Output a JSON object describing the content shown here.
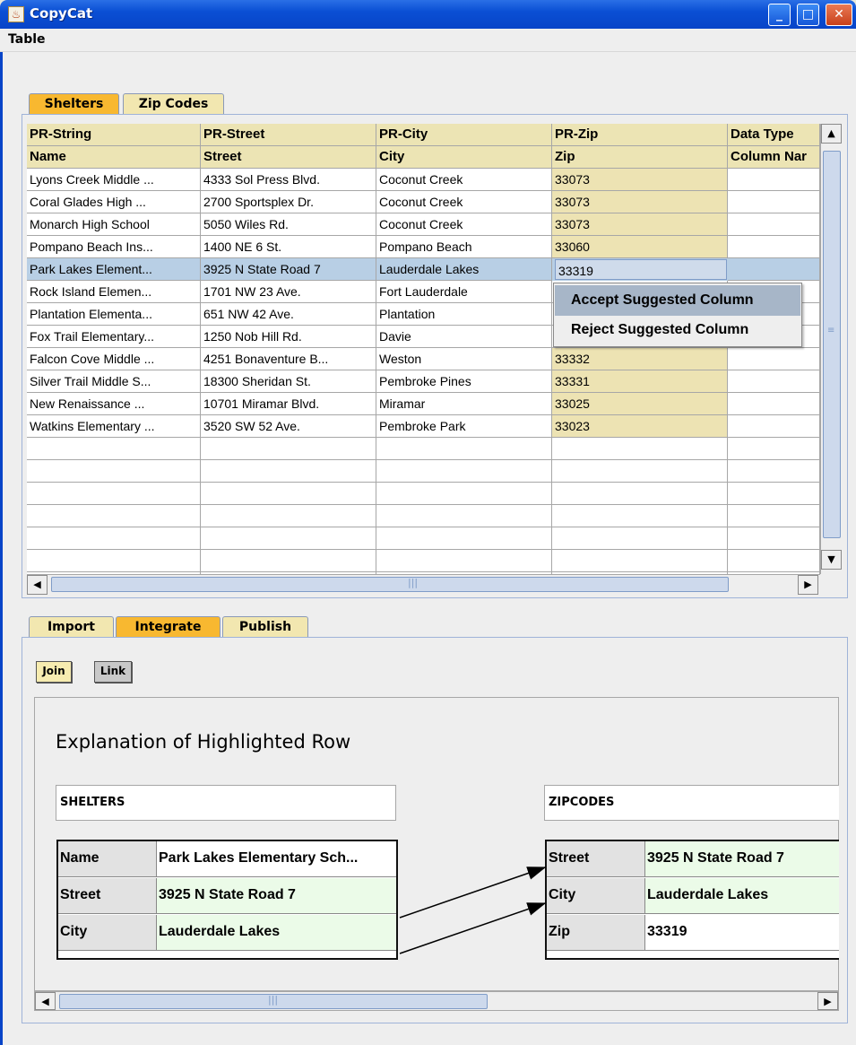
{
  "window": {
    "title": "CopyCat",
    "app_icon": "java-cup-icon",
    "buttons": [
      "minimize",
      "maximize",
      "close"
    ],
    "minimize_glyph": "_",
    "maximize_glyph": "□",
    "close_glyph": "✕"
  },
  "menu": {
    "items": [
      "Table"
    ]
  },
  "top_tabs": [
    {
      "label": "Shelters",
      "active": true
    },
    {
      "label": "Zip Codes",
      "active": false
    }
  ],
  "table": {
    "header1": [
      "PR-String",
      "PR-Street",
      "PR-City",
      "PR-Zip",
      "Data Type"
    ],
    "header2": [
      "Name",
      "Street",
      "City",
      "Zip",
      "Column Nar"
    ],
    "rows": [
      [
        "Lyons Creek Middle ...",
        "4333 Sol Press Blvd.",
        "Coconut Creek",
        "33073",
        ""
      ],
      [
        "Coral Glades High ...",
        "2700 Sportsplex Dr.",
        "Coconut Creek",
        "33073",
        ""
      ],
      [
        "Monarch High School",
        "5050 Wiles Rd.",
        "Coconut Creek",
        "33073",
        ""
      ],
      [
        "Pompano Beach Ins...",
        "1400 NE 6 St.",
        "Pompano Beach",
        "33060",
        ""
      ],
      [
        "Park Lakes Element...",
        "3925 N State Road 7",
        "Lauderdale Lakes",
        "33319",
        ""
      ],
      [
        "Rock Island Elemen...",
        "1701 NW 23 Ave.",
        "Fort Lauderdale",
        "",
        ""
      ],
      [
        "Plantation Elementa...",
        "651 NW 42 Ave.",
        "Plantation",
        "",
        ""
      ],
      [
        "Fox Trail Elementary...",
        "1250 Nob Hill Rd.",
        "Davie",
        "",
        ""
      ],
      [
        "Falcon Cove Middle ...",
        "4251 Bonaventure B...",
        "Weston",
        "33332",
        ""
      ],
      [
        "Silver Trail Middle S...",
        "18300 Sheridan St.",
        "Pembroke Pines",
        "33331",
        ""
      ],
      [
        "New Renaissance ...",
        "10701 Miramar Blvd.",
        "Miramar",
        "33025",
        ""
      ],
      [
        "Watkins Elementary ...",
        "3520 SW 52 Ave.",
        "Pembroke Park",
        "33023",
        ""
      ]
    ],
    "selected_row": 4,
    "scroll_up_glyph": "▲",
    "scroll_down_glyph": "▼",
    "scroll_left_glyph": "◀",
    "scroll_right_glyph": "▶",
    "grip_glyph": "|||",
    "vgrip_glyph": "≡"
  },
  "context_menu": {
    "items": [
      "Accept Suggested Column",
      "Reject Suggested Column"
    ],
    "highlighted": 0
  },
  "bottom_tabs": [
    {
      "label": "Import",
      "active": false
    },
    {
      "label": "Integrate",
      "active": true
    },
    {
      "label": "Publish",
      "active": false
    }
  ],
  "buttons": {
    "join": "Join",
    "link": "Link"
  },
  "explanation": {
    "title": "Explanation of Highlighted Row",
    "left": {
      "label": "SHELTERS",
      "rows": [
        [
          "Name",
          "Park Lakes Elementary Sch..."
        ],
        [
          "Street",
          "3925 N State Road 7"
        ],
        [
          "City",
          "Lauderdale Lakes"
        ]
      ]
    },
    "right": {
      "label": "ZIPCODES",
      "rows": [
        [
          "Street",
          "3925 N State Road 7"
        ],
        [
          "City",
          "Lauderdale Lakes"
        ],
        [
          "Zip",
          "33319"
        ]
      ]
    }
  },
  "colors": {
    "titlebar": "#0a4fd4",
    "active_tab": "#f8b830",
    "zip_column": "#ede3b3",
    "selection": "#b8cfe5",
    "match_green": "#ebfbe8"
  }
}
